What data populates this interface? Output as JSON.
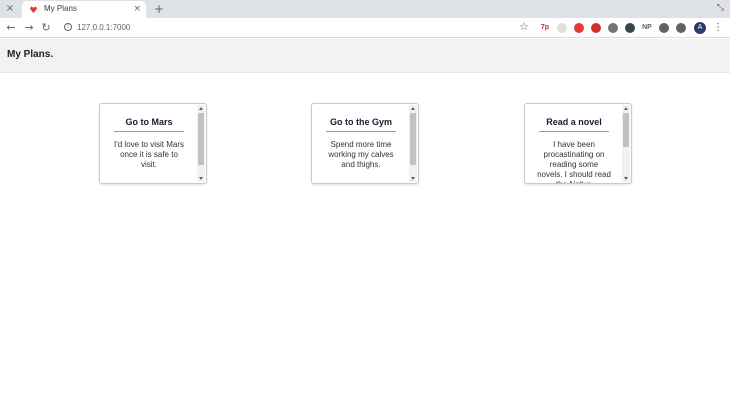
{
  "browser": {
    "tab": {
      "title": "My Plans",
      "close_glyph": "×"
    },
    "left_close_glyph": "×",
    "new_tab_glyph": "+",
    "window_control_glyph": "⤡",
    "back_glyph": "←",
    "forward_glyph": "→",
    "reload_glyph": "↻",
    "info_glyph": "i",
    "url": "127.0.0.1:7000",
    "star_glyph": "☆",
    "extensions": [
      {
        "name": "extension-7p-icon",
        "label": "7p",
        "color": "#c62828"
      },
      {
        "name": "extension-grey-icon",
        "label": "",
        "color": "#e0e0e0"
      },
      {
        "name": "extension-red-circle-icon",
        "label": "",
        "color": "#e53935"
      },
      {
        "name": "extension-shield-icon",
        "label": "",
        "color": "#d32f2f"
      },
      {
        "name": "extension-globe-icon",
        "label": "",
        "color": "#757575"
      },
      {
        "name": "extension-cube-icon",
        "label": "",
        "color": "#37474f"
      },
      {
        "name": "extension-np-icon",
        "label": "NP",
        "color": "#5f6368"
      },
      {
        "name": "extensions-puzzle-icon",
        "label": "",
        "color": "#5f6368"
      },
      {
        "name": "reading-list-icon",
        "label": "",
        "color": "#5f6368"
      }
    ],
    "avatar_letter": "A",
    "menu_glyph": "⋮",
    "accent_favicon_color": "#e53935"
  },
  "header": {
    "title": "My Plans."
  },
  "cards": [
    {
      "title": "Go to Mars",
      "text": "I'd love to visit Mars once it is safe to visit.",
      "scroll_thumb_fraction": 0.85
    },
    {
      "title": "Go to the Gym",
      "text": "Spend more time working my calves and thighs.",
      "scroll_thumb_fraction": 0.85
    },
    {
      "title": "Read a novel",
      "text": "I have been procastinating on reading some novels. I should read the Native",
      "scroll_thumb_fraction": 0.55
    }
  ]
}
